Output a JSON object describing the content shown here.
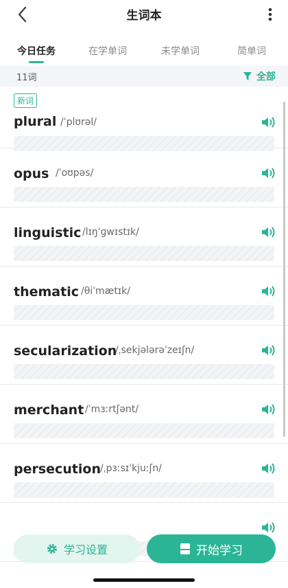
{
  "header": {
    "title": "生词本",
    "back_icon": "chevron-left-icon",
    "more_icon": "vertical-dots-icon"
  },
  "tabs": [
    {
      "label": "今日任务",
      "active": true
    },
    {
      "label": "在学单词",
      "active": false
    },
    {
      "label": "未学单词",
      "active": false
    },
    {
      "label": "简单词",
      "active": false
    }
  ],
  "filterbar": {
    "count": "11词",
    "filter_label": "全部",
    "filter_icon": "funnel-icon"
  },
  "words": [
    {
      "word": "plural",
      "phonetic": "/ˈplʊrəl/",
      "badge": "新词"
    },
    {
      "word": "opus",
      "phonetic": "/ˈoʊpəs/"
    },
    {
      "word": "linguistic",
      "phonetic": "/lɪŋˈɡwɪstɪk/"
    },
    {
      "word": "thematic",
      "phonetic": "/θiˈmætɪk/"
    },
    {
      "word": "secularization",
      "phonetic": "/ˌsekjələrəˈzeɪʃn/"
    },
    {
      "word": "merchant",
      "phonetic": "/ˈmɜːrtʃənt/"
    },
    {
      "word": "persecution",
      "phonetic": "/ˌpɜːsɪˈkjuːʃn/"
    }
  ],
  "bottom": {
    "settings_label": "学习设置",
    "start_label": "开始学习"
  },
  "colors": {
    "accent": "#2bb596",
    "settings_bg": "#e3f5ef"
  }
}
